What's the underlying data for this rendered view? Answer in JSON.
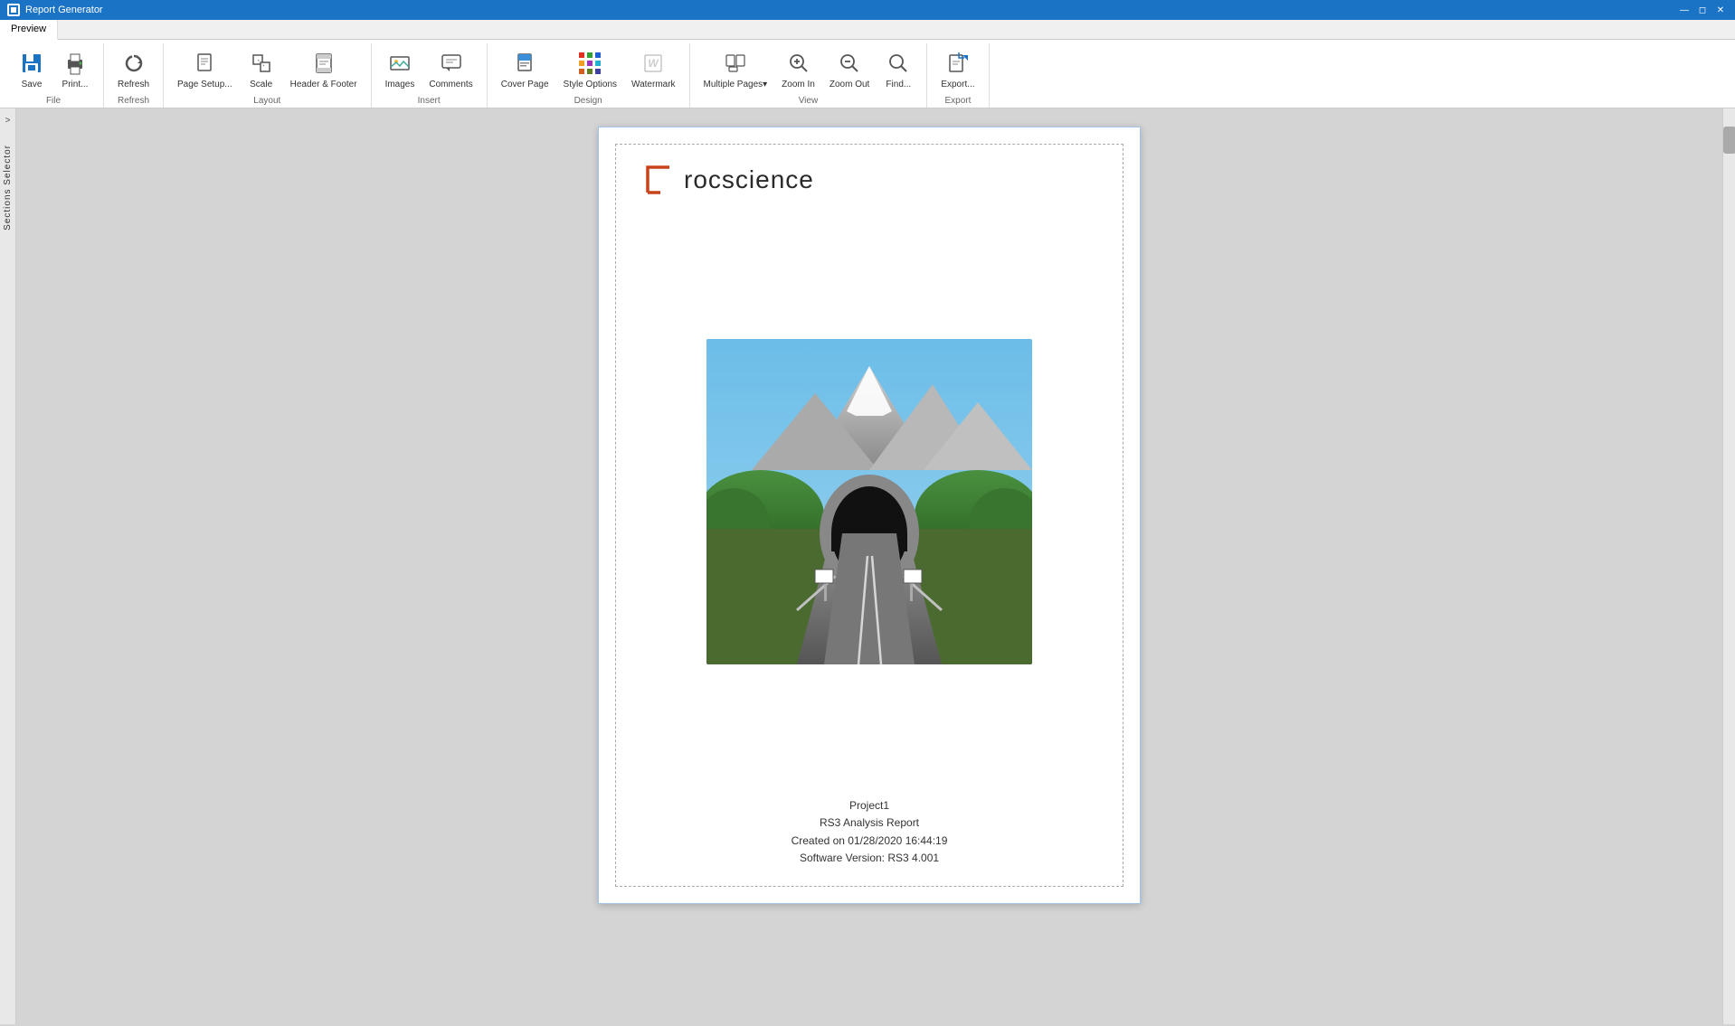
{
  "titleBar": {
    "title": "Report Generator",
    "controls": [
      "minimize",
      "restore",
      "close"
    ]
  },
  "ribbon": {
    "tabs": [
      {
        "id": "preview",
        "label": "Preview",
        "active": true
      }
    ],
    "groups": [
      {
        "id": "file",
        "label": "File",
        "buttons": [
          {
            "id": "save",
            "label": "Save",
            "icon": "save-icon"
          },
          {
            "id": "print",
            "label": "Print...",
            "icon": "print-icon"
          }
        ]
      },
      {
        "id": "refresh",
        "label": "Refresh",
        "buttons": [
          {
            "id": "refresh",
            "label": "Refresh",
            "icon": "refresh-icon"
          }
        ]
      },
      {
        "id": "layout",
        "label": "Layout",
        "buttons": [
          {
            "id": "page-setup",
            "label": "Page\nSetup...",
            "icon": "page-setup-icon"
          },
          {
            "id": "scale",
            "label": "Scale",
            "icon": "scale-icon"
          },
          {
            "id": "header-footer",
            "label": "Header &\nFooter",
            "icon": "header-footer-icon"
          }
        ]
      },
      {
        "id": "insert",
        "label": "Insert",
        "buttons": [
          {
            "id": "images",
            "label": "Images",
            "icon": "images-icon"
          },
          {
            "id": "comments",
            "label": "Comments",
            "icon": "comments-icon"
          }
        ]
      },
      {
        "id": "design",
        "label": "Design",
        "buttons": [
          {
            "id": "cover-page",
            "label": "Cover\nPage",
            "icon": "cover-page-icon"
          },
          {
            "id": "style-options",
            "label": "Style\nOptions",
            "icon": "style-options-icon"
          },
          {
            "id": "watermark",
            "label": "Watermark",
            "icon": "watermark-icon"
          }
        ]
      },
      {
        "id": "view",
        "label": "View",
        "buttons": [
          {
            "id": "multiple-pages",
            "label": "Multiple\nPages▾",
            "icon": "multiple-pages-icon"
          },
          {
            "id": "zoom-in",
            "label": "Zoom\nIn",
            "icon": "zoom-in-icon"
          },
          {
            "id": "zoom-out",
            "label": "Zoom\nOut",
            "icon": "zoom-out-icon"
          },
          {
            "id": "find",
            "label": "Find...",
            "icon": "find-icon"
          }
        ]
      },
      {
        "id": "export",
        "label": "Export",
        "buttons": [
          {
            "id": "export",
            "label": "Export...",
            "icon": "export-icon"
          }
        ]
      }
    ]
  },
  "sectionsSelector": {
    "label": "Sections Selector",
    "arrow": ">"
  },
  "page": {
    "logo": {
      "text": "rocscience"
    },
    "footer": {
      "line1": "Project1",
      "line2": "RS3 Analysis Report",
      "line3": "Created on 01/28/2020 16:44:19",
      "line4": "Software Version: RS3 4.001"
    }
  },
  "colors": {
    "accent": "#1a73c5",
    "logoOrange": "#c8421a",
    "ribbonBg": "#f0f0f0"
  }
}
